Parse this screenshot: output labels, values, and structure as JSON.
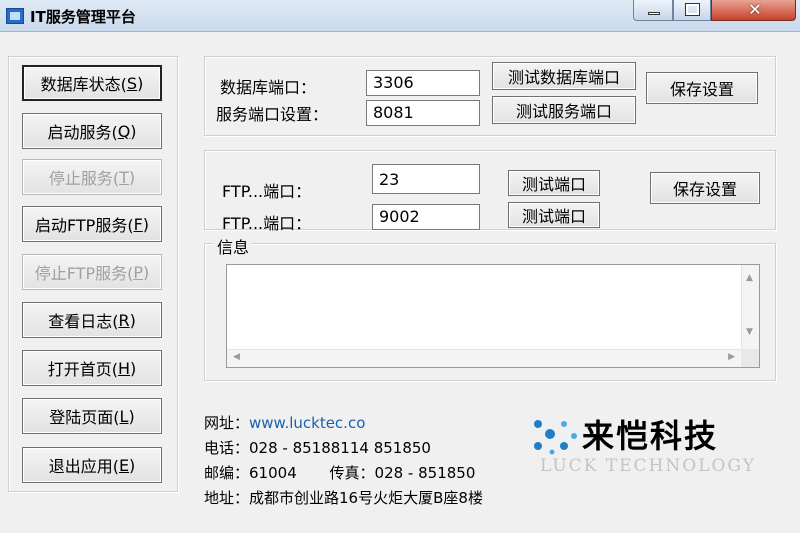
{
  "window": {
    "title": "IT服务管理平台"
  },
  "sidebar": {
    "buttons": [
      {
        "label": "数据库状态(",
        "key": "S",
        "end": ")",
        "state": "focused"
      },
      {
        "label": "启动服务(",
        "key": "Q",
        "end": ")",
        "state": "normal"
      },
      {
        "label": "停止服务(",
        "key": "T",
        "end": ")",
        "state": "disabled"
      },
      {
        "label": "启动FTP服务(",
        "key": "F",
        "end": ")",
        "state": "normal"
      },
      {
        "label": "停止FTP服务(",
        "key": "P",
        "end": ")",
        "state": "disabled"
      },
      {
        "label": "查看日志(",
        "key": "R",
        "end": ")",
        "state": "normal"
      },
      {
        "label": "打开首页(",
        "key": "H",
        "end": ")",
        "state": "normal"
      },
      {
        "label": "登陆页面(",
        "key": "L",
        "end": ")",
        "state": "normal"
      },
      {
        "label": "退出应用(",
        "key": "E",
        "end": ")",
        "state": "normal"
      }
    ]
  },
  "db_group": {
    "db_port_label": "数据库端口：",
    "db_port_value": "3306",
    "service_port_label": "服务端口设置：",
    "service_port_value": "8081",
    "test_db_port_button": "测试数据库端口",
    "test_service_port_button": "测试服务端口",
    "save_button": "保存设置"
  },
  "ftp_group": {
    "port1_label": "FTP...端口：",
    "port1_value": "23",
    "port2_label": "FTP...端口：",
    "port2_value": "9002",
    "test_port_button_1": "测试端口",
    "test_port_button_2": "测试端口",
    "save_button": "保存设置"
  },
  "info_group": {
    "title": "信息",
    "content": ""
  },
  "footer": {
    "website_label": "网址：",
    "website_value": "www.lucktec.co",
    "phone_label": "电话：",
    "phone_value": "028 - 85188114 851850",
    "postcode_label": "邮编：",
    "postcode_value": "61004",
    "fax_label": "传真：",
    "fax_value": "028 - 851850",
    "address_label": "地址：",
    "address_value": "成都市创业路16号火炬大厦B座8楼"
  },
  "logo": {
    "name_cn": "来恺科技",
    "name_en": "LUCK TECHNOLOGY"
  },
  "colors": {
    "link": "#1a5fb4",
    "logo_blue": "#1e7fc8"
  }
}
